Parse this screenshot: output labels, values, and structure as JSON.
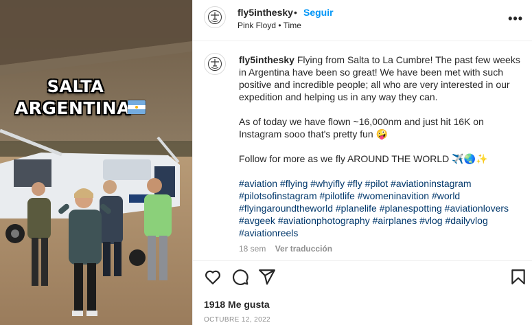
{
  "media": {
    "overlay_line1": "SALTA",
    "overlay_line2": "ARGENTINA",
    "flag_icon": "argentina-flag-icon"
  },
  "post": {
    "username": "fly5inthesky",
    "separator": "•",
    "follow_label": "Seguir",
    "subline": "Pink Floyd • Time",
    "more_icon": "more-options-icon",
    "more_label": "•••"
  },
  "caption": {
    "username": "fly5inthesky",
    "paragraph1": "Flying from Salta to La Cumbre! The past few weeks in Argentina have been so great! We have been met with such positive and incredible people; all who are very interested in our expedition and helping us in any way they can.",
    "paragraph2": "As of today we have flown ~16,000nm and just hit 16K on Instagram sooo that's pretty fun 🤪",
    "paragraph3": "Follow for more as we fly AROUND THE WORLD ✈️🌏✨",
    "hashtags": [
      "#aviation",
      "#flying",
      "#whyifly",
      "#fly",
      "#pilot",
      "#aviationinstagram",
      "#pilotsofinstagram",
      "#pilotlife",
      "#womeninavition",
      "#world",
      "#flyingaroundtheworld",
      "#planelife",
      "#planespotting",
      "#aviationlovers",
      "#avgeek",
      "#aviationphotography",
      "#airplanes",
      "#vlog",
      "#dailyvlog",
      "#aviationreels"
    ],
    "age": "18 sem",
    "translate_label": "Ver traducción"
  },
  "actions": {
    "like_icon": "heart-icon",
    "comment_icon": "comment-icon",
    "share_icon": "share-icon",
    "save_icon": "bookmark-icon"
  },
  "stats": {
    "likes": "1918 Me gusta",
    "date": "OCTUBRE 12, 2022"
  },
  "colors": {
    "link_blue": "#0095f6",
    "hashtag": "#00376b",
    "muted": "#8e8e8e",
    "text": "#262626",
    "border": "#efefef"
  }
}
